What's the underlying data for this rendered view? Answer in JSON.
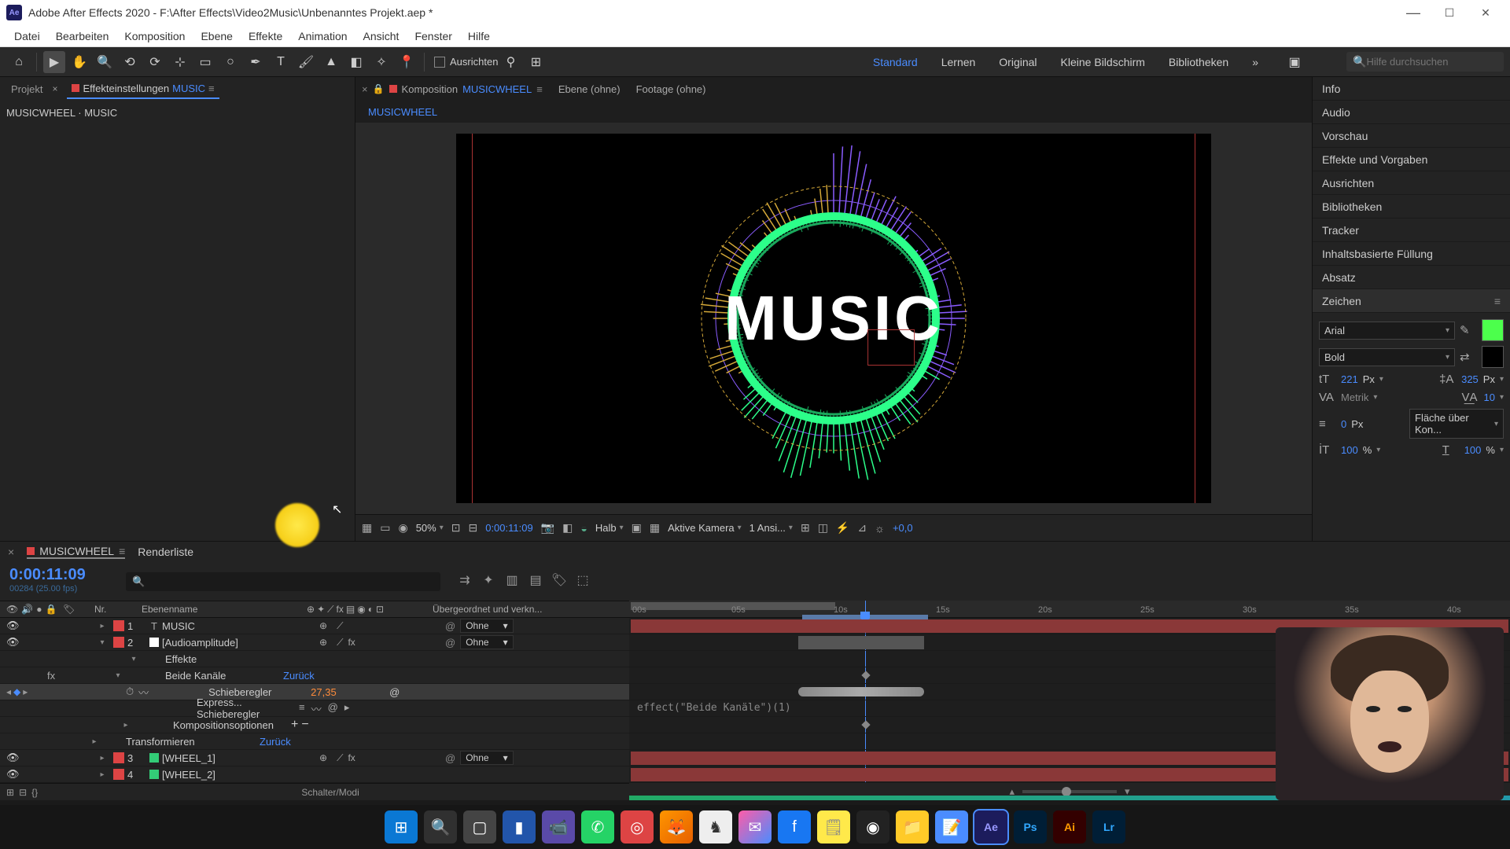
{
  "titlebar": {
    "app_icon": "Ae",
    "title": "Adobe After Effects 2020 - F:\\After Effects\\Video2Music\\Unbenanntes Projekt.aep *"
  },
  "menubar": [
    "Datei",
    "Bearbeiten",
    "Komposition",
    "Ebene",
    "Effekte",
    "Animation",
    "Ansicht",
    "Fenster",
    "Hilfe"
  ],
  "toolbar": {
    "align_label": "Ausrichten",
    "workspaces": {
      "active": "Standard",
      "items": [
        "Standard",
        "Lernen",
        "Original",
        "Kleine Bildschirm",
        "Bibliotheken"
      ]
    },
    "search_placeholder": "Hilfe durchsuchen"
  },
  "left_panel": {
    "tab_project": "Projekt",
    "tab_effects": "Effekteinstellungen",
    "effects_layer": "MUSIC",
    "path": "MUSICWHEEL · MUSIC"
  },
  "center": {
    "tab_comp_prefix": "Komposition",
    "tab_comp_name": "MUSICWHEEL",
    "tab_layer": "Ebene (ohne)",
    "tab_footage": "Footage (ohne)",
    "breadcrumb": "MUSICWHEEL",
    "stage_text": "MUSIC"
  },
  "viewer_footer": {
    "zoom": "50%",
    "timecode": "0:00:11:09",
    "resolution": "Halb",
    "camera": "Aktive Kamera",
    "views": "1 Ansi...",
    "exposure": "+0,0"
  },
  "right_panels": {
    "items": [
      "Info",
      "Audio",
      "Vorschau",
      "Effekte und Vorgaben",
      "Ausrichten",
      "Bibliotheken",
      "Tracker",
      "Inhaltsbasierte Füllung",
      "Absatz"
    ],
    "zeichen_title": "Zeichen",
    "zeichen": {
      "font": "Arial",
      "weight": "Bold",
      "fill_color": "#4cff4c",
      "size": "221",
      "size_unit": "Px",
      "leading": "325",
      "leading_unit": "Px",
      "kerning": "Metrik",
      "tracking": "10",
      "stroke": "0",
      "stroke_unit": "Px",
      "stroke_mode": "Fläche über Kon...",
      "hscale": "100",
      "hscale_unit": "%",
      "vscale": "100",
      "vscale_unit": "%"
    }
  },
  "timeline": {
    "tab_name": "MUSICWHEEL",
    "tab_render": "Renderliste",
    "timecode": "0:00:11:09",
    "fps": "00284 (25.00 fps)",
    "cols": {
      "nr": "Nr.",
      "name": "Ebenenname",
      "parent": "Übergeordnet und verkn..."
    },
    "parent_none": "Ohne",
    "reset": "Zurück",
    "footer": "Schalter/Modi",
    "ruler": [
      "00s",
      "05s",
      "10s",
      "15s",
      "20s",
      "25s",
      "30s",
      "35s",
      "40s"
    ],
    "rows": {
      "r1": {
        "nr": "1",
        "name": "MUSIC",
        "type": "T"
      },
      "r2": {
        "nr": "2",
        "name": "[Audioamplitude]"
      },
      "effekte": "Effekte",
      "beide": "Beide Kanäle",
      "schie": "Schieberegler",
      "schie_val": "27,35",
      "express": "Express... Schieberegler",
      "kompopt": "Kompositionsoptionen",
      "transform": "Transformieren",
      "r3": {
        "nr": "3",
        "name": "[WHEEL_1]"
      },
      "r4": {
        "nr": "4",
        "name": "[WHEEL_2]"
      },
      "expression": "effect(\"Beide Kanäle\")(1)"
    }
  }
}
